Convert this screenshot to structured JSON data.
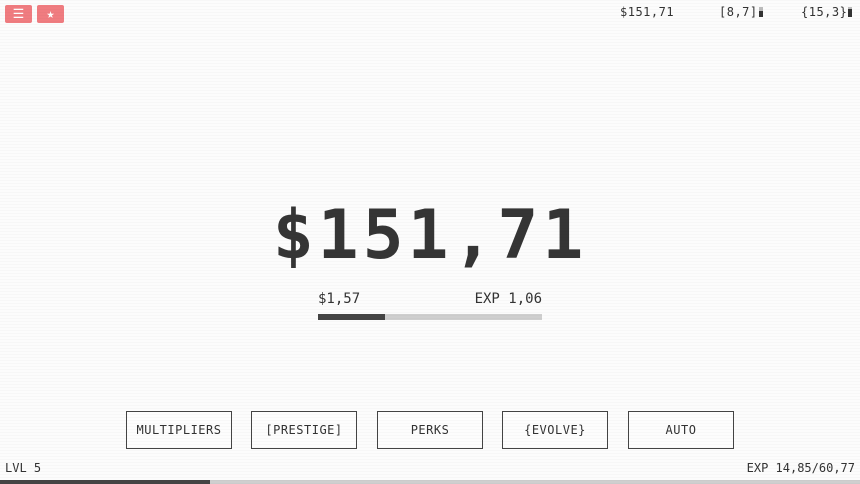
{
  "header": {
    "menu_icon": "☰",
    "star_icon": "★",
    "money": "$151,71",
    "bracket_stat": "[8,7]",
    "bracket_level": 0.6,
    "brace_stat": "{15,3}",
    "brace_level": 0.8
  },
  "main": {
    "money": "$151,71",
    "rate_money": "$1,57",
    "rate_exp": "EXP 1,06",
    "progress": 0.3
  },
  "actions": {
    "multipliers": "MULTIPLIERS",
    "prestige": "[PRESTIGE]",
    "perks": "PERKS",
    "evolve": "{EVOLVE}",
    "auto": "AUTO"
  },
  "footer": {
    "level": "LVL 5",
    "exp": "EXP 14,85/60,77",
    "exp_progress": 0.244
  },
  "colors": {
    "accent": "#f07c80",
    "text": "#353535",
    "bar_fill": "#444444",
    "bar_track": "#cfcfcf"
  }
}
